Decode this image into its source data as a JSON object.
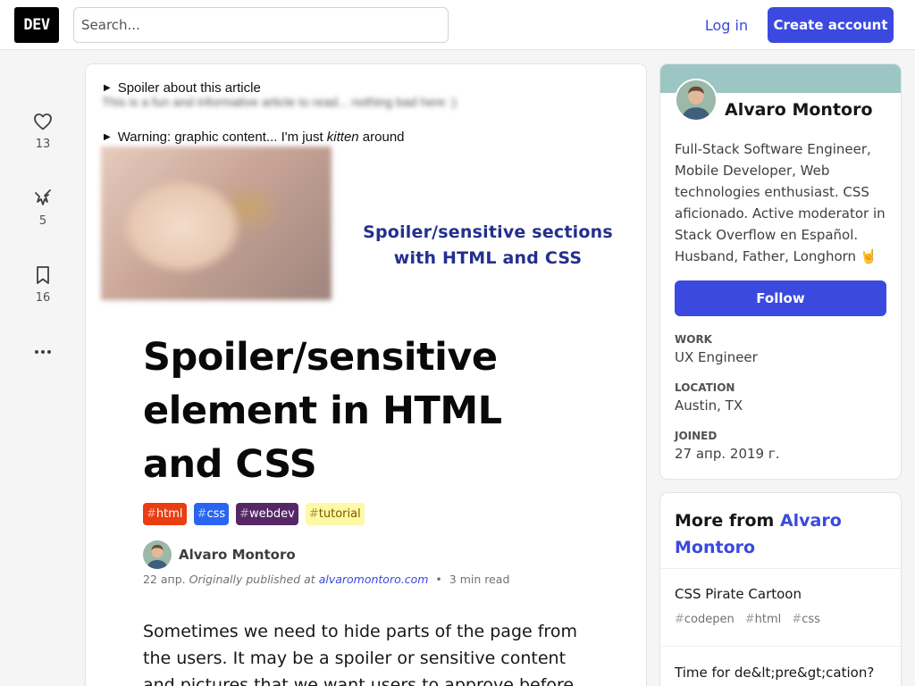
{
  "header": {
    "logo": "DEV",
    "search_placeholder": "Search...",
    "login": "Log in",
    "create_account": "Create account"
  },
  "reactions": {
    "likes": "13",
    "unicorns": "5",
    "bookmarks": "16"
  },
  "cover": {
    "spoiler_summary": "Spoiler about this article",
    "spoiler_hidden": "This is a fun and informative article to read... nothing bad here :)",
    "warning_summary_pre": "Warning: graphic content... I'm just ",
    "warning_summary_em": "kitten",
    "warning_summary_post": " around",
    "title_line1": "Spoiler/sensitive sections",
    "title_line2": "with HTML and CSS"
  },
  "article": {
    "title": "Spoiler/sensitive element in HTML and CSS",
    "tags": [
      {
        "name": "html",
        "color": "#ea3d12",
        "text_color": "#ffffff"
      },
      {
        "name": "css",
        "color": "#2965f1",
        "text_color": "#ffffff"
      },
      {
        "name": "webdev",
        "color": "#562765",
        "text_color": "#ffffff"
      },
      {
        "name": "tutorial",
        "color": "#fef9a5",
        "text_color": "#7a5b00"
      }
    ],
    "author": "Alvaro Montoro",
    "date": "22 апр.",
    "published_prefix": "Originally published at",
    "published_link": "alvaromontoro.com",
    "read_time": "3 min read",
    "body": "Sometimes we need to hide parts of the page from the users. It may be a spoiler or sensitive content and pictures that we want users to approve before"
  },
  "profile": {
    "name": "Alvaro Montoro",
    "bio": "Full-Stack Software Engineer, Mobile Developer, Web technologies enthusiast. CSS aficionado. Active moderator in Stack Overflow en Español. Husband, Father, Longhorn 🤘",
    "follow": "Follow",
    "work_label": "Work",
    "work": "UX Engineer",
    "location_label": "Location",
    "location": "Austin, TX",
    "joined_label": "Joined",
    "joined": "27 апр. 2019 г."
  },
  "more_from": {
    "prefix": "More from",
    "author": "Alvaro Montoro",
    "items": [
      {
        "title": "CSS Pirate Cartoon",
        "tags": [
          "codepen",
          "html",
          "css"
        ]
      },
      {
        "title": "Time for de&lt;pre&gt;cation?",
        "tags": []
      }
    ]
  },
  "colors": {
    "accent": "#3b49df",
    "profile_band": "#9cc6c4",
    "cover_title": "#23308e"
  }
}
